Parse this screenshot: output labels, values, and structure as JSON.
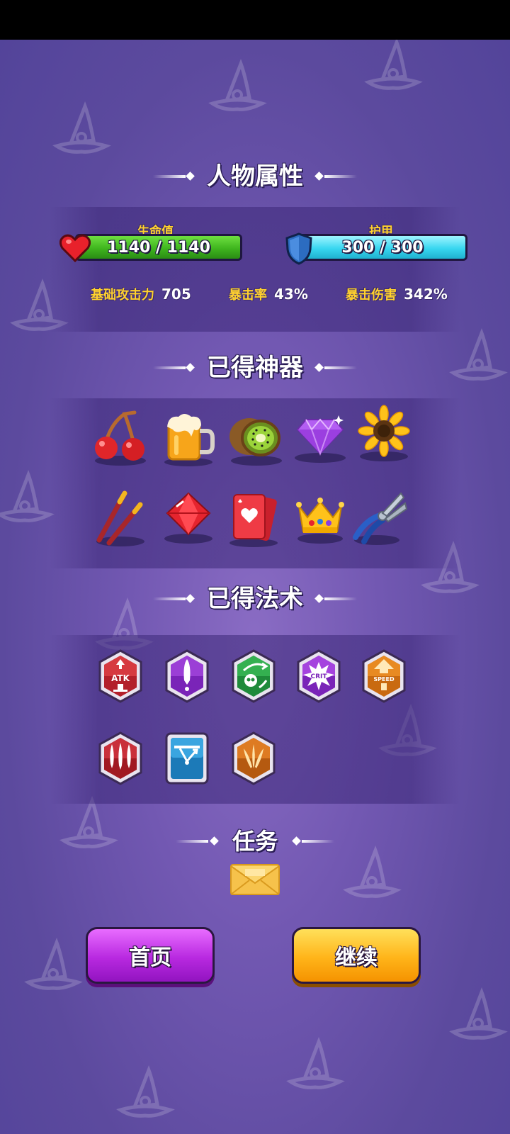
{
  "sections": {
    "attributes_title": "人物属性",
    "artifacts_title": "已得神器",
    "spells_title": "已得法术",
    "tasks_title": "任务"
  },
  "hp": {
    "label": "生命值",
    "value": "1140 / 1140",
    "current": 1140,
    "max": 1140
  },
  "armor": {
    "label": "护甲",
    "value": "300 / 300",
    "current": 300,
    "max": 300
  },
  "stats": [
    {
      "label": "基础攻击力",
      "value": "705"
    },
    {
      "label": "暴击率",
      "value": "43%"
    },
    {
      "label": "暴击伤害",
      "value": "342%"
    }
  ],
  "artifacts": [
    "cherry-icon",
    "beer-mug-icon",
    "kiwi-icon",
    "purple-gem-icon",
    "sunflower-icon",
    "chopsticks-icon",
    "red-gem-icon",
    "playing-card-icon",
    "crown-icon",
    "pliers-icon"
  ],
  "spells": [
    {
      "icon": "attack-up-spell-icon",
      "text": "ATK"
    },
    {
      "icon": "purple-arrow-spell-icon",
      "text": ""
    },
    {
      "icon": "poison-skull-spell-icon",
      "text": ""
    },
    {
      "icon": "crit-spell-icon",
      "text": "CRIT"
    },
    {
      "icon": "speed-up-spell-icon",
      "text": "SPEED"
    },
    {
      "icon": "triple-arrow-spell-icon",
      "text": ""
    },
    {
      "icon": "ricochet-spell-icon",
      "text": ""
    },
    {
      "icon": "spread-shot-spell-icon",
      "text": ""
    }
  ],
  "task_icon": "envelope-icon",
  "buttons": {
    "home": "首页",
    "continue": "继续"
  },
  "colors": {
    "background": "#6a53aa",
    "hp_green": "#3fb51e",
    "armor_cyan": "#38d7f0",
    "stat_label_yellow": "#ffd12e",
    "home_purple": "#b829e0",
    "continue_orange": "#ffb419"
  }
}
